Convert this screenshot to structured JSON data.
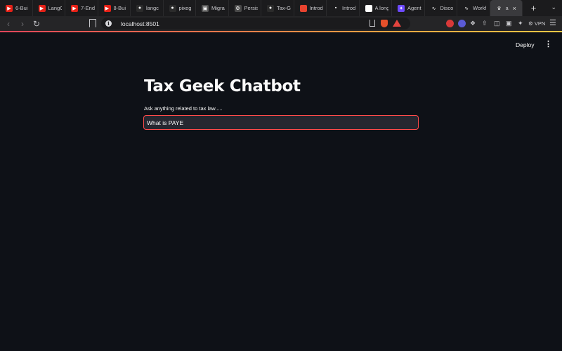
{
  "browser": {
    "tabs": [
      {
        "title": "6-Bui",
        "icon": "youtube-icon",
        "color": "#e62117"
      },
      {
        "title": "LangC",
        "icon": "youtube-icon",
        "color": "#e62117"
      },
      {
        "title": "7-End",
        "icon": "youtube-icon",
        "color": "#e62117"
      },
      {
        "title": "8-Bui",
        "icon": "youtube-icon",
        "color": "#e62117"
      },
      {
        "title": "langc",
        "icon": "github-icon",
        "color": "#2b2b2b"
      },
      {
        "title": "pixeg",
        "icon": "github-icon",
        "color": "#2b2b2b"
      },
      {
        "title": "Migra",
        "icon": "robot-icon",
        "color": "#555555"
      },
      {
        "title": "Persis",
        "icon": "gear-icon",
        "color": "#4a4a4a"
      },
      {
        "title": "Tax-G",
        "icon": "github-icon",
        "color": "#2b2b2b"
      },
      {
        "title": "Introd",
        "icon": "red-square-icon",
        "color": "#e8432f"
      },
      {
        "title": "Introd",
        "icon": "dark-doc-icon",
        "color": "#1b1b1d"
      },
      {
        "title": "A long",
        "icon": "link-icon",
        "color": "#ffffff"
      },
      {
        "title": "Agent",
        "icon": "purple-app-icon",
        "color": "#6d4aff"
      },
      {
        "title": "Disco",
        "icon": "wave-icon",
        "color": "#1b1b1d"
      },
      {
        "title": "Workf",
        "icon": "wave-icon",
        "color": "#1b1b1d"
      }
    ],
    "active_tab": {
      "title": "a",
      "icon": "crown-icon"
    },
    "new_tab_label": "+",
    "url": "localhost:8501",
    "vpn_label": "VPN",
    "accent_colors": {
      "brave": "#e5502b",
      "load_bar": "#f07a4b"
    }
  },
  "app": {
    "deploy_label": "Deploy",
    "title": "Tax Geek Chatbot",
    "input_label": "Ask anything related to tax law.....",
    "input_value": "What is PAYE",
    "input_border_color": "#ff4b4b"
  }
}
